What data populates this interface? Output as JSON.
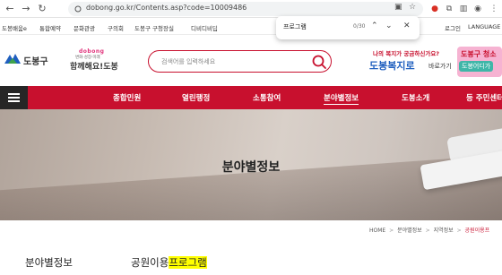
{
  "browser": {
    "url": "dobong.go.kr/Contents.asp?code=10009486",
    "find": {
      "query": "프로그램",
      "count": "0/30"
    }
  },
  "util_bar": {
    "links": [
      "도봉배움e",
      "통합예약",
      "문화관광",
      "구의회",
      "도봉구 구청장실",
      "디비디비딥"
    ],
    "right_links": [
      "로그인",
      "LANGUAGE"
    ]
  },
  "header": {
    "logo_text": "도봉구",
    "slogan": {
      "top": "dobong",
      "middle": "변화·성장·미래",
      "bottom": "함께해요!도봉"
    },
    "search_placeholder": "검색어를 입력하세요",
    "banner1": {
      "line1": "나의 복지가 궁금하신가요?",
      "line2": "도봉복지로",
      "line3": "바로가기"
    },
    "banner2": {
      "line1": "도봉구 청소",
      "line2": "도봉어디가"
    }
  },
  "gnb": {
    "items": [
      "종합민원",
      "열린행정",
      "소통참여",
      "분야별정보",
      "도봉소개",
      "등 주민센터"
    ],
    "active_index": 3
  },
  "hero": {
    "title": "분야별정보"
  },
  "breadcrumb": {
    "items": [
      "HOME",
      "분야별정보",
      "지역정보",
      "공원이용프"
    ],
    "separator": ">"
  },
  "page": {
    "lnb_title": "분야별정보",
    "content_title_plain": "공원이용",
    "content_title_highlight": "프로그램"
  },
  "colors": {
    "brand_red": "#c8102e",
    "highlight": "#ffff00"
  }
}
